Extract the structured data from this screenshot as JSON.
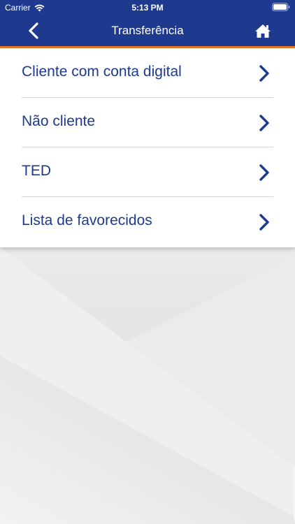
{
  "status_bar": {
    "carrier": "Carrier",
    "time": "5:13 PM"
  },
  "nav": {
    "title": "Transferência",
    "back_icon": "chevron-left-icon",
    "home_icon": "home-icon"
  },
  "colors": {
    "brand_blue": "#1e3a8f",
    "accent_orange": "#e87722"
  },
  "menu": {
    "items": [
      {
        "label": "Cliente com conta digital"
      },
      {
        "label": "Não cliente"
      },
      {
        "label": "TED"
      },
      {
        "label": "Lista de favorecidos"
      }
    ]
  }
}
